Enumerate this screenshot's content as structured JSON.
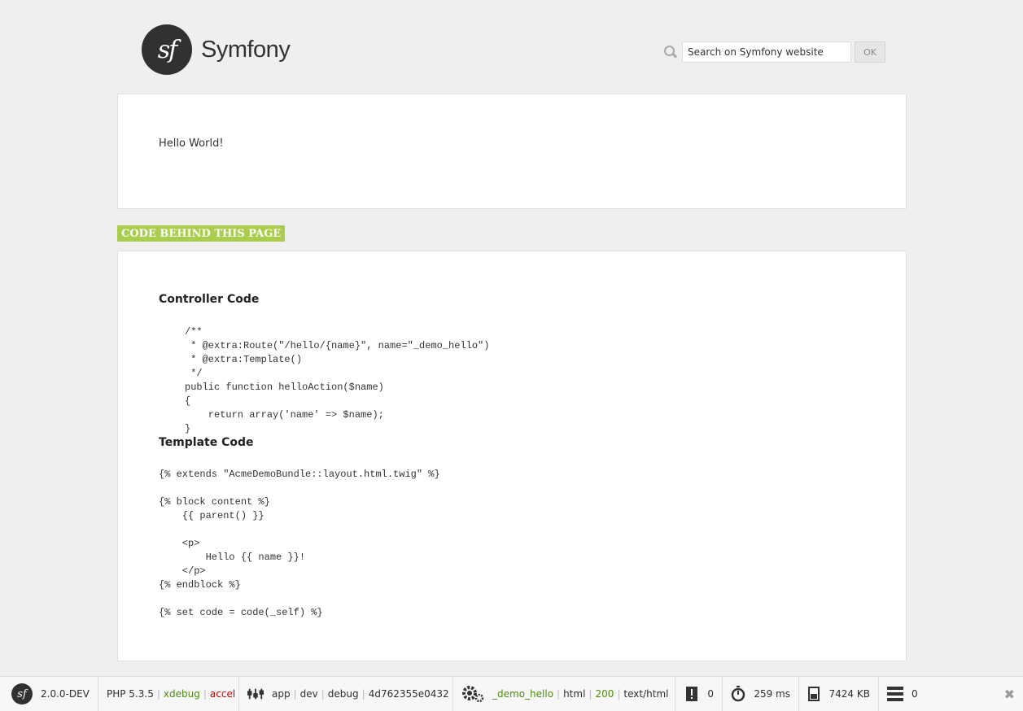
{
  "header": {
    "logo_text": "Symfony",
    "logo_mark": "sf",
    "search_placeholder": "Search on Symfony website",
    "search_button": "OK"
  },
  "content": {
    "hello_text": "Hello World!",
    "code_label": "CODE BEHIND THIS PAGE",
    "controller_title": "Controller Code",
    "controller_code": "/**\n * @extra:Route(\"/hello/{name}\", name=\"_demo_hello\")\n * @extra:Template()\n */\npublic function helloAction($name)\n{\n    return array('name' => $name);\n}",
    "template_title": "Template Code",
    "template_code": "{% extends \"AcmeDemoBundle::layout.html.twig\" %}\n\n{% block content %}\n    {{ parent() }}\n\n    <p>\n        Hello {{ name }}!\n    </p>\n{% endblock %}\n\n{% set code = code(_self) %}"
  },
  "toolbar": {
    "logo_mark": "sf",
    "version": "2.0.0-DEV",
    "php_version": "PHP 5.3.5",
    "xdebug": "xdebug",
    "accel": "accel",
    "app": "app",
    "env": "dev",
    "debug": "debug",
    "token": "4d762355e0432",
    "route": "_demo_hello",
    "format": "html",
    "status": "200",
    "content_type": "text/html",
    "exceptions": "0",
    "time": "259 ms",
    "memory": "7424 KB",
    "db_queries": "0",
    "close": "✖"
  },
  "colors": {
    "accent_green": "#aacd4e",
    "ok_green": "#4f8a10",
    "error_red": "#c00"
  },
  "icons": {
    "toolbar_icons": [
      "config-icon",
      "request-gear-icon",
      "exception-icon",
      "timer-icon",
      "memory-icon",
      "database-icon",
      "close-icon"
    ]
  }
}
